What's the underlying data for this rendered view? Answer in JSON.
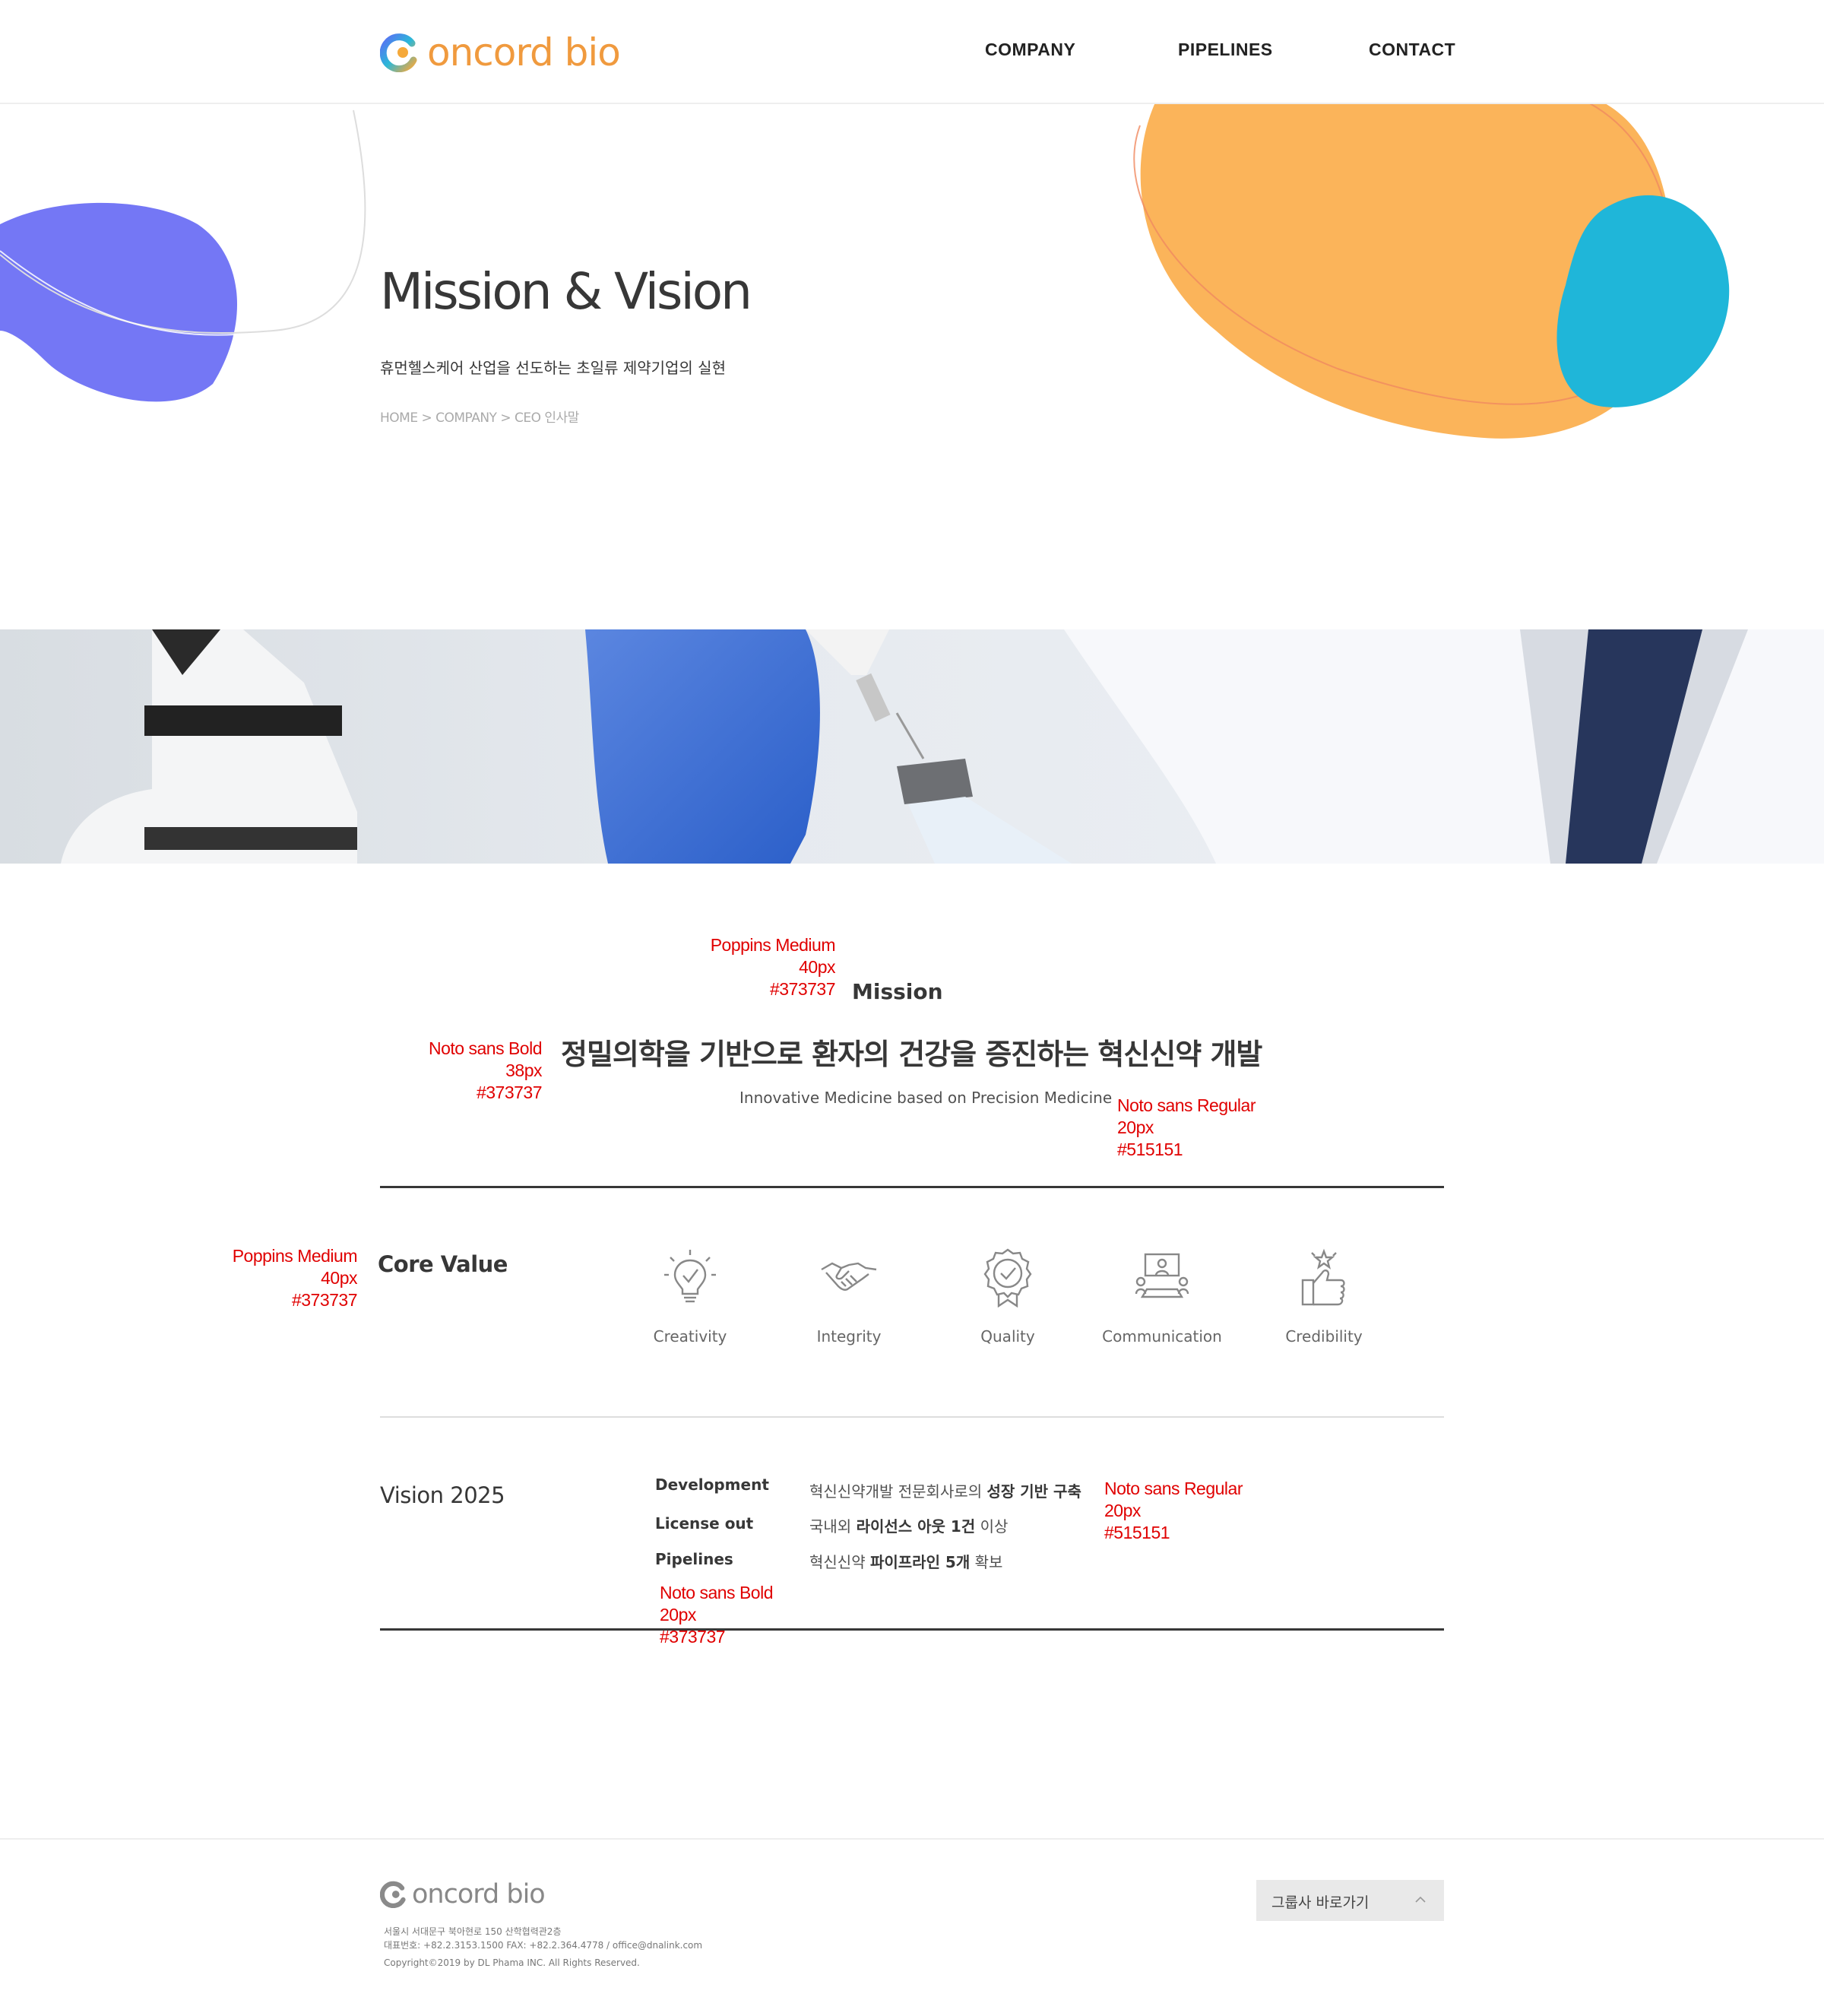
{
  "header": {
    "logo_text": "oncord bio",
    "nav": [
      "COMPANY",
      "PIPELINES",
      "CONTACT"
    ]
  },
  "hero": {
    "title": "Mission & Vision",
    "subtitle": "휴먼헬스케어 산업을 선도하는 초일류 제약기업의 실현",
    "breadcrumb": "HOME > COMPANY > CEO 인사말"
  },
  "mission": {
    "heading": "Mission",
    "statement": "정밀의학을 기반으로 환자의 건강을 증진하는 혁신신약 개발",
    "english": "Innovative Medicine based on Precision Medicine"
  },
  "core_value": {
    "heading": "Core Value",
    "items": [
      {
        "label": "Creativity",
        "icon": "lightbulb-icon"
      },
      {
        "label": "Integrity",
        "icon": "handshake-icon"
      },
      {
        "label": "Quality",
        "icon": "badge-check-icon"
      },
      {
        "label": "Communication",
        "icon": "meeting-icon"
      },
      {
        "label": "Credibility",
        "icon": "thumbs-up-star-icon"
      }
    ]
  },
  "vision": {
    "heading": "Vision 2025",
    "rows": [
      {
        "key": "Development",
        "pre": "혁신신약개발 전문회사로의 ",
        "bold": "성장 기반 구축",
        "post": ""
      },
      {
        "key": "License out",
        "pre": "국내외 ",
        "bold": "라이선스 아웃 1건",
        "post": " 이상"
      },
      {
        "key": "Pipelines",
        "pre": "혁신신약 ",
        "bold": "파이프라인 5개",
        "post": " 확보"
      }
    ]
  },
  "annotations": {
    "mission_heading": [
      "Poppins Medium",
      "40px",
      "#373737"
    ],
    "mission_statement": [
      "Noto sans Bold",
      "38px",
      "#373737"
    ],
    "mission_english": [
      "Noto sans Regular",
      "20px",
      "#515151"
    ],
    "core_value": [
      "Poppins Medium",
      "40px",
      "#373737"
    ],
    "vision_values": [
      "Noto sans Regular",
      "20px",
      "#515151"
    ],
    "vision_keys": [
      "Noto sans Bold",
      "20px",
      "#373737"
    ]
  },
  "footer": {
    "logo_text": "oncord bio",
    "address": "서울시 서대문구 북아현로 150 산학협력관2층",
    "contact": "대표번호: +82.2.3153.1500   FAX: +82.2.364.4778 / office@dnalink.com",
    "copyright": "Copyright©2019 by DL Phama INC. All Rights Reserved.",
    "family_button": "그룹사 바로가기"
  },
  "colors": {
    "text_main": "#373737",
    "text_sub": "#515151",
    "annotation": "#e00000",
    "blob_purple": "#7477f5",
    "blob_orange": "#fbb45a",
    "blob_cyan": "#1fb6d9"
  }
}
